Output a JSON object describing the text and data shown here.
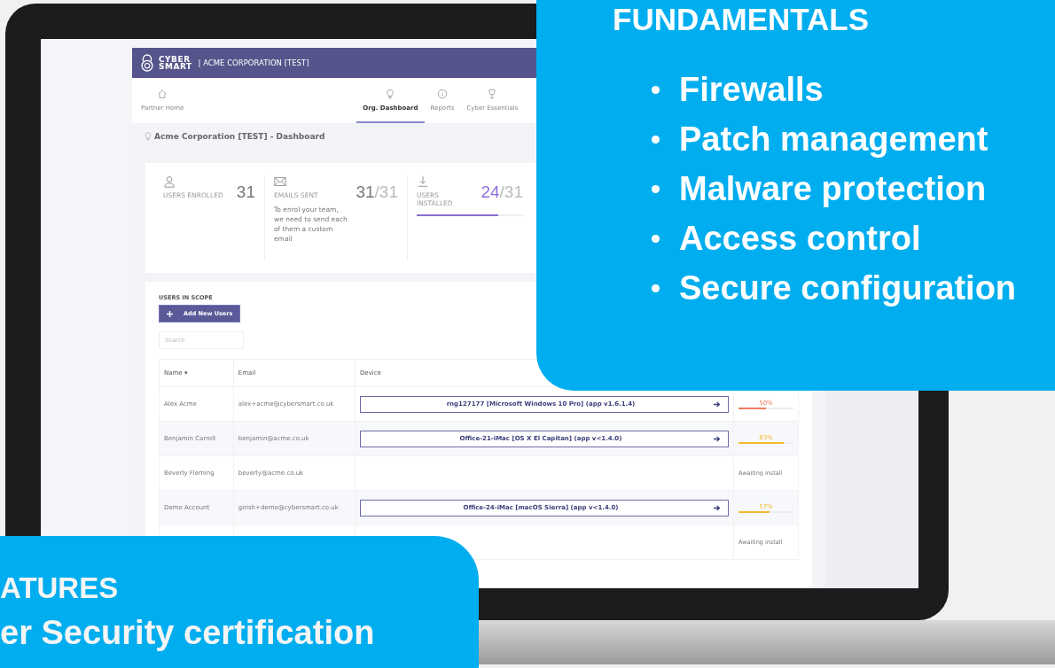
{
  "app": {
    "logo": [
      "CYBER",
      "SMART"
    ],
    "org_title": "| ACME CORPORATION [TEST]",
    "nav": [
      {
        "label": "Partner Home",
        "selected": false
      },
      {
        "label": "Org. Dashboard",
        "selected": true
      },
      {
        "label": "Reports",
        "selected": false
      },
      {
        "label": "Cyber Essentials",
        "selected": false
      }
    ],
    "page_title": "Acme Corporation [TEST] - Dashboard",
    "stats": [
      {
        "kind": "plain",
        "label": "USERS ENROLLED",
        "value": "31"
      },
      {
        "kind": "fraction",
        "label": "EMAILS SENT",
        "value": "31",
        "total": "/31",
        "note": "To enrol your team, we need to send each of them a custom email"
      },
      {
        "kind": "progress",
        "label": "USERS INSTALLED",
        "value": "24",
        "total": "/31",
        "level": 0.77
      }
    ],
    "users": {
      "heading": "USERS IN SCOPE",
      "add_button": "Add New Users",
      "search": {
        "placeholder": "Search"
      },
      "columns": [
        "Name ▾",
        "Email",
        "Device"
      ],
      "rows": [
        {
          "name": "Alex Acme",
          "email": "alex+acme@cybersmart.co.uk",
          "device": "rng127177 [Microsoft Windows 10 Pro] (app v1.6.1.4)",
          "status": {
            "kind": "progress",
            "reading": "50%",
            "level": 0.5,
            "color": "#f07a5f"
          }
        },
        {
          "name": "Benjamin Carroll",
          "email": "benjamin@acme.co.uk",
          "device": "Office-21-iMac [OS X El Capitan] (app v<1.4.0)",
          "status": {
            "kind": "progress",
            "reading": "83%",
            "level": 0.83,
            "color": "#f5b82e"
          }
        },
        {
          "name": "Beverly Fleming",
          "email": "beverly@acme.co.uk",
          "status": {
            "kind": "text",
            "text": "Awaiting install"
          }
        },
        {
          "name": "Demo Account",
          "email": "girish+demo@cybersmart.co.uk",
          "device": "Office-24-iMac [macOS Sierra] (app v<1.4.0)",
          "status": {
            "kind": "progress",
            "reading": "57%",
            "level": 0.57,
            "color": "#f5b82e"
          }
        },
        {
          "status": {
            "kind": "text",
            "text": "Awaiting install"
          }
        }
      ]
    }
  },
  "fundamentals": {
    "title": "FUNDAMENTALS",
    "items": [
      "Firewalls",
      "Patch management",
      "Malware protection",
      "Access control",
      "Secure configuration"
    ]
  },
  "features": {
    "lines": [
      "ATURES",
      "er Security certification"
    ]
  }
}
